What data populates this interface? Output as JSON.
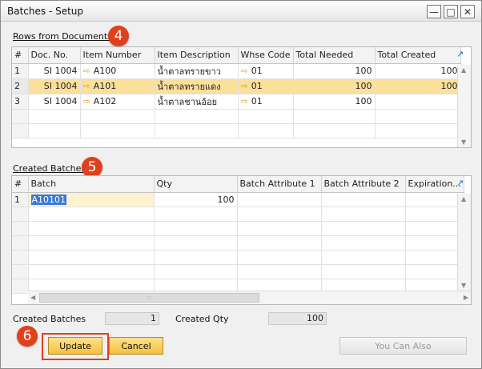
{
  "window": {
    "title": "Batches - Setup",
    "controls": [
      "minimize",
      "maximize",
      "close"
    ]
  },
  "rows_section": {
    "label": "Rows from Documents",
    "callout": "4",
    "columns": [
      "#",
      "Doc. No.",
      "Item Number",
      "Item Description",
      "Whse Code",
      "Total Needed",
      "Total Created"
    ],
    "rows": [
      {
        "num": "1",
        "doc": "SI 1004",
        "item": "A100",
        "desc": "น้ำตาลทรายขาว",
        "whse": "01",
        "needed": "100",
        "created": "100"
      },
      {
        "num": "2",
        "doc": "SI 1004",
        "item": "A101",
        "desc": "น้ำตาลทรายแดง",
        "whse": "01",
        "needed": "100",
        "created": "100"
      },
      {
        "num": "3",
        "doc": "SI 1004",
        "item": "A102",
        "desc": "น้ำตาลชานอ้อย",
        "whse": "01",
        "needed": "100",
        "created": ""
      }
    ],
    "selected_row": "2"
  },
  "batches_section": {
    "label": "Created Batches",
    "callout": "5",
    "columns": [
      "#",
      "Batch",
      "Qty",
      "Batch Attribute 1",
      "Batch Attribute 2",
      "Expiration..."
    ],
    "rows": [
      {
        "num": "1",
        "batch": "A10101",
        "qty": "100",
        "attr1": "",
        "attr2": "",
        "exp": ""
      }
    ],
    "hscroll_grip": "::"
  },
  "footer": {
    "created_batches_label": "Created Batches",
    "created_batches_value": "1",
    "created_qty_label": "Created Qty",
    "created_qty_value": "100"
  },
  "buttons": {
    "callout": "6",
    "update": "Update",
    "cancel": "Cancel",
    "you_can_also": "You Can Also"
  },
  "colors": {
    "accent_button": "#f5c13c",
    "selected_row": "#fbe09c",
    "callout": "#e0401c"
  }
}
